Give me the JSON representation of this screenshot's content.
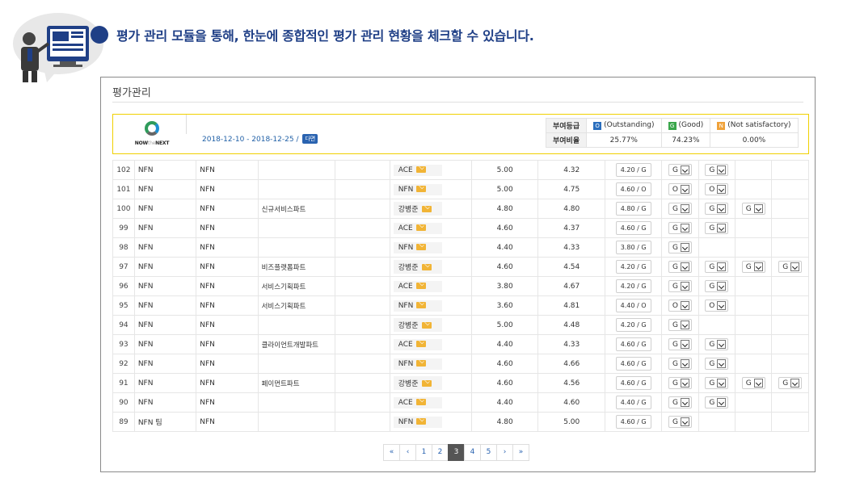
{
  "headline": "평가 관리 모듈을 통해, 한눈에 종합적인 평가 관리 현황을 체크할 수 있습니다.",
  "panel": {
    "title": "평가관리"
  },
  "info": {
    "logo_text_a": "NOW",
    "logo_text_b": "the",
    "logo_text_c": "NEXT",
    "period": "2018-12-10 - 2018-12-25  /",
    "period_tag": "다면",
    "grade_label": "부여등급",
    "ratio_label": "부여비율",
    "grades": [
      {
        "code": "O",
        "label": "(Outstanding)",
        "ratio": "25.77%"
      },
      {
        "code": "G",
        "label": "(Good)",
        "ratio": "74.23%"
      },
      {
        "code": "N",
        "label": "(Not satisfactory)",
        "ratio": "0.00%"
      }
    ]
  },
  "rows": [
    {
      "no": "102",
      "c1": "NFN",
      "c2": "NFN",
      "dept": "",
      "who": "ACE",
      "s1": "5.00",
      "s2": "4.32",
      "res": "4.20 / G",
      "sels": [
        "G",
        "G",
        "",
        ""
      ]
    },
    {
      "no": "101",
      "c1": "NFN",
      "c2": "NFN",
      "dept": "",
      "who": "NFN",
      "s1": "5.00",
      "s2": "4.75",
      "res": "4.60 / O",
      "sels": [
        "O",
        "O",
        "",
        ""
      ]
    },
    {
      "no": "100",
      "c1": "NFN",
      "c2": "NFN",
      "dept": "신규서비스파트",
      "who": "강병준",
      "s1": "4.80",
      "s2": "4.80",
      "res": "4.80 / G",
      "sels": [
        "G",
        "G",
        "G",
        ""
      ]
    },
    {
      "no": "99",
      "c1": "NFN",
      "c2": "NFN",
      "dept": "",
      "who": "ACE",
      "s1": "4.60",
      "s2": "4.37",
      "res": "4.60 / G",
      "sels": [
        "G",
        "G",
        "",
        ""
      ]
    },
    {
      "no": "98",
      "c1": "NFN",
      "c2": "NFN",
      "dept": "",
      "who": "NFN",
      "s1": "4.40",
      "s2": "4.33",
      "res": "3.80 / G",
      "sels": [
        "G",
        "",
        "",
        ""
      ]
    },
    {
      "no": "97",
      "c1": "NFN",
      "c2": "NFN",
      "dept": "비즈플랫폼파트",
      "who": "강병준",
      "s1": "4.60",
      "s2": "4.54",
      "res": "4.20 / G",
      "sels": [
        "G",
        "G",
        "G",
        "G"
      ]
    },
    {
      "no": "96",
      "c1": "NFN",
      "c2": "NFN",
      "dept": "서비스기획파트",
      "who": "ACE",
      "s1": "3.80",
      "s2": "4.67",
      "res": "4.20 / G",
      "sels": [
        "G",
        "G",
        "",
        ""
      ]
    },
    {
      "no": "95",
      "c1": "NFN",
      "c2": "NFN",
      "dept": "서비스기획파트",
      "who": "NFN",
      "s1": "3.60",
      "s2": "4.81",
      "res": "4.40 / O",
      "sels": [
        "O",
        "O",
        "",
        ""
      ]
    },
    {
      "no": "94",
      "c1": "NFN",
      "c2": "NFN",
      "dept": "",
      "who": "강병준",
      "s1": "5.00",
      "s2": "4.48",
      "res": "4.20 / G",
      "sels": [
        "G",
        "",
        "",
        ""
      ]
    },
    {
      "no": "93",
      "c1": "NFN",
      "c2": "NFN",
      "dept": "클라이언트개발파트",
      "who": "ACE",
      "s1": "4.40",
      "s2": "4.33",
      "res": "4.60 / G",
      "sels": [
        "G",
        "G",
        "",
        ""
      ]
    },
    {
      "no": "92",
      "c1": "NFN",
      "c2": "NFN",
      "dept": "",
      "who": "NFN",
      "s1": "4.60",
      "s2": "4.66",
      "res": "4.60 / G",
      "sels": [
        "G",
        "G",
        "",
        ""
      ]
    },
    {
      "no": "91",
      "c1": "NFN",
      "c2": "NFN",
      "dept": "페이먼트파트",
      "who": "강병준",
      "s1": "4.60",
      "s2": "4.56",
      "res": "4.60 / G",
      "sels": [
        "G",
        "G",
        "G",
        "G"
      ]
    },
    {
      "no": "90",
      "c1": "NFN",
      "c2": "NFN",
      "dept": "",
      "who": "ACE",
      "s1": "4.40",
      "s2": "4.60",
      "res": "4.40 / G",
      "sels": [
        "G",
        "G",
        "",
        ""
      ]
    },
    {
      "no": "89",
      "c1": "NFN   팀",
      "c2": "NFN",
      "dept": "",
      "who": "NFN",
      "s1": "4.80",
      "s2": "5.00",
      "res": "4.60 / G",
      "sels": [
        "G",
        "",
        "",
        ""
      ]
    }
  ],
  "pager": {
    "first": "«",
    "prev": "‹",
    "pages": [
      "1",
      "2",
      "3",
      "4",
      "5"
    ],
    "active": "3",
    "next": "›",
    "last": "»"
  },
  "colors": {
    "headline": "#1f3f86",
    "highlight_border": "#f0d000",
    "mail": "#f1b436"
  }
}
